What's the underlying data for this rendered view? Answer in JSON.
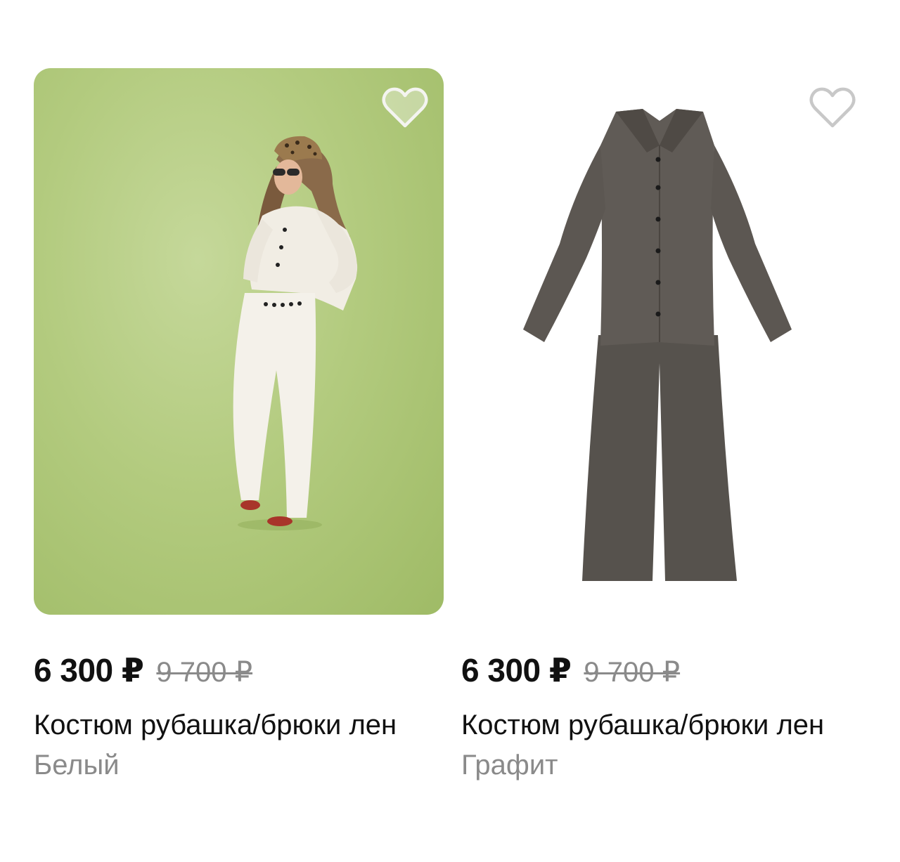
{
  "products": [
    {
      "price": "6 300 ₽",
      "old_price": "9 700 ₽",
      "title": "Костюм рубашка/брюки лен",
      "color": "Белый",
      "image": "woman-in-white-linen-suit-on-green-background",
      "favorite_icon": "heart-outline-icon",
      "background_color": "#b3cb7f"
    },
    {
      "price": "6 300 ₽",
      "old_price": "9 700 ₽",
      "title": "Костюм рубашка/брюки лен",
      "color": "Графит",
      "image": "graphite-linen-shirt-and-trousers-flatlay",
      "favorite_icon": "heart-outline-icon",
      "garment_color": "#5a5550"
    }
  ]
}
